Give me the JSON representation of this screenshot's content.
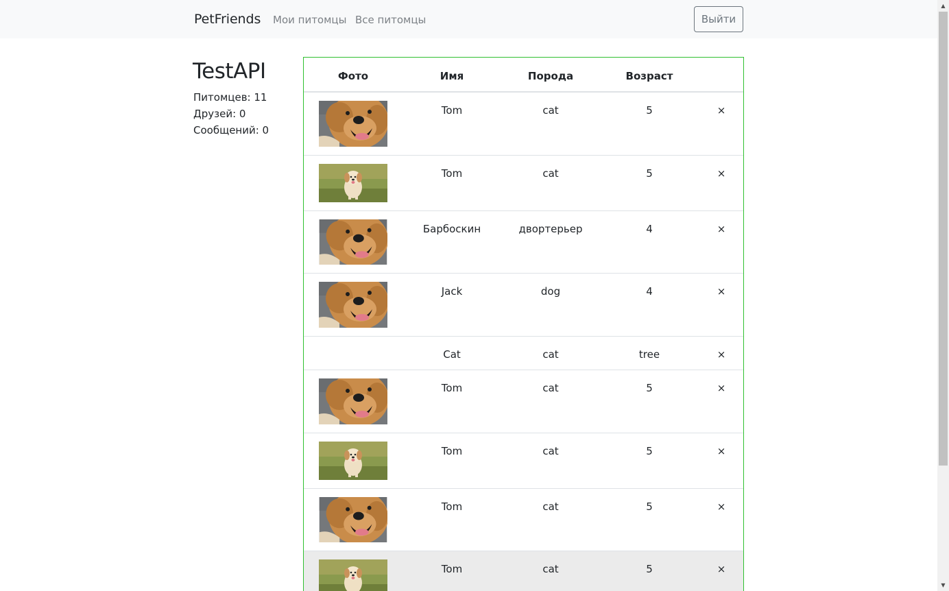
{
  "navbar": {
    "brand": "PetFriends",
    "links": [
      {
        "label": "Мои питомцы"
      },
      {
        "label": "Все питомцы"
      }
    ],
    "logout_label": "Выйти"
  },
  "profile": {
    "name": "TestAPI",
    "pets_count": "Питомцев: 11",
    "friends_count": "Друзей: 0",
    "messages_count": "Сообщений: 0"
  },
  "table": {
    "headers": {
      "photo": "Фото",
      "name": "Имя",
      "breed": "Порода",
      "age": "Возраст"
    },
    "delete_symbol": "×",
    "rows": [
      {
        "photo": "golden-retriever-face",
        "name": "Tom",
        "breed": "cat",
        "age": "5"
      },
      {
        "photo": "puppy-on-grass",
        "name": "Tom",
        "breed": "cat",
        "age": "5"
      },
      {
        "photo": "golden-retriever-face",
        "name": "Барбоскин",
        "breed": "двортерьер",
        "age": "4"
      },
      {
        "photo": "golden-retriever-face",
        "name": "Jack",
        "breed": "dog",
        "age": "4"
      },
      {
        "photo": "",
        "name": "Cat",
        "breed": "cat",
        "age": "tree"
      },
      {
        "photo": "golden-retriever-face",
        "name": "Tom",
        "breed": "cat",
        "age": "5"
      },
      {
        "photo": "puppy-on-grass",
        "name": "Tom",
        "breed": "cat",
        "age": "5"
      },
      {
        "photo": "golden-retriever-face",
        "name": "Tom",
        "breed": "cat",
        "age": "5"
      },
      {
        "photo": "puppy-on-grass",
        "name": "Tom",
        "breed": "cat",
        "age": "5"
      }
    ]
  },
  "colors": {
    "table_border": "#2fc02f",
    "navbar_bg": "#f8f9fa",
    "row_hover": "#ebebeb"
  }
}
